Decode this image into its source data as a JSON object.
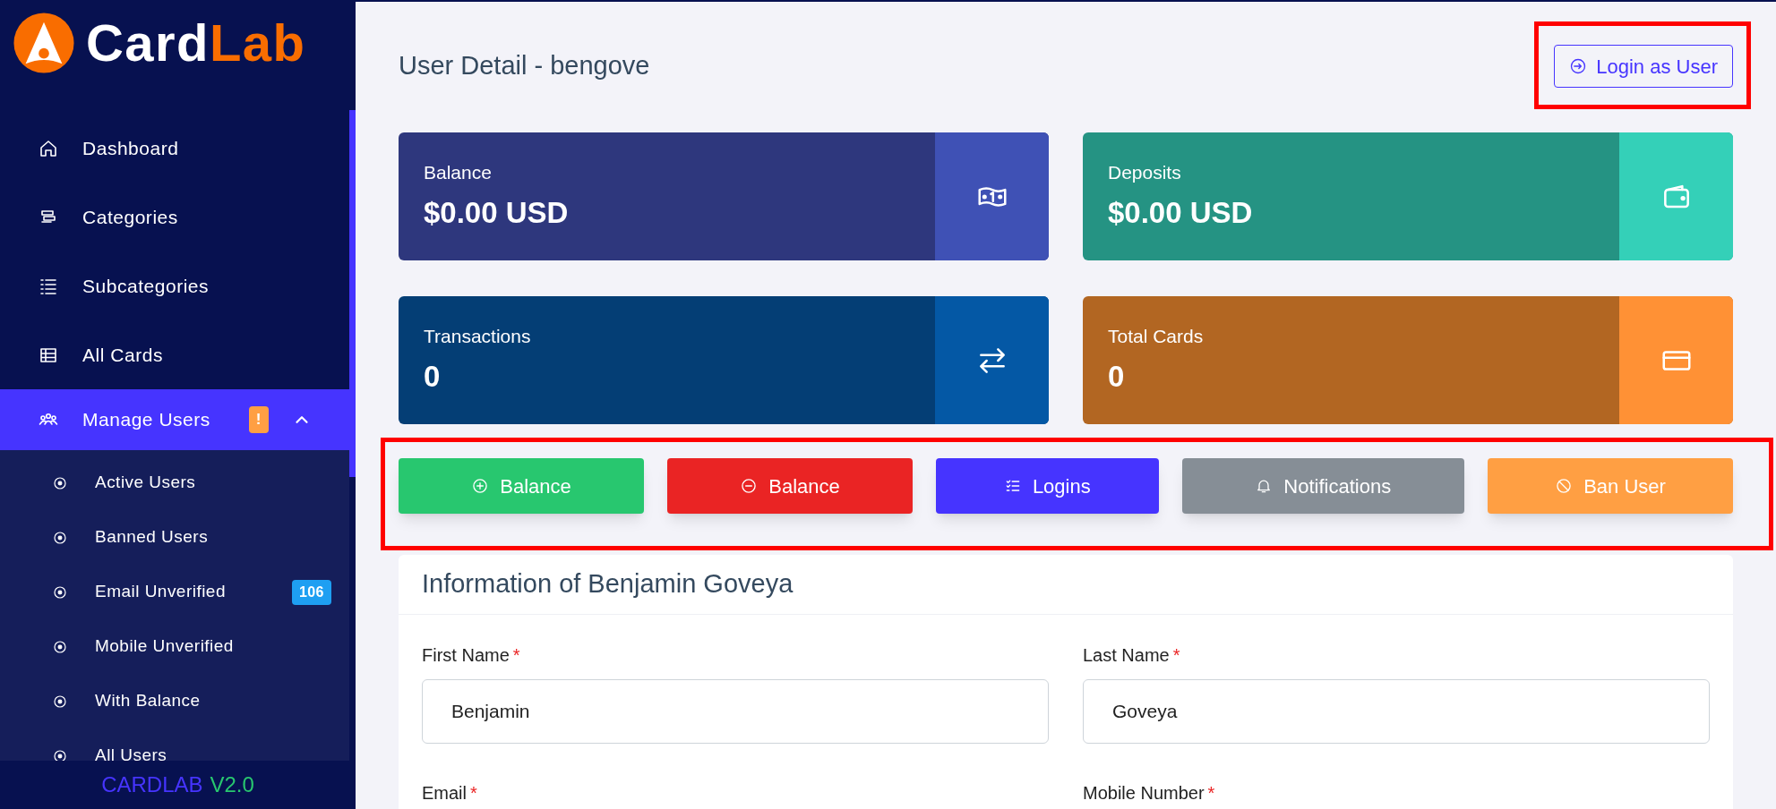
{
  "logo": {
    "text_1": "Card",
    "text_2": "Lab"
  },
  "sidebar": {
    "items": [
      {
        "label": "Dashboard",
        "kind": "link",
        "selected": false
      },
      {
        "label": "Categories",
        "kind": "link",
        "selected": false
      },
      {
        "label": "Subcategories",
        "kind": "link",
        "selected": false
      },
      {
        "label": "All Cards",
        "kind": "link",
        "selected": false
      },
      {
        "label": "Manage Users",
        "kind": "group",
        "selected": true,
        "expanded": true,
        "badge": {
          "text": "!",
          "color": "#ff9f43"
        },
        "children": [
          {
            "label": "Active Users"
          },
          {
            "label": "Banned Users"
          },
          {
            "label": "Email Unverified",
            "badge": {
              "text": "106",
              "color": "#1e9ff2"
            }
          },
          {
            "label": "Mobile Unverified"
          },
          {
            "label": "With Balance"
          },
          {
            "label": "All Users"
          }
        ]
      }
    ],
    "footer": {
      "name": "CARDLAB",
      "version": "V2.0"
    }
  },
  "header": {
    "title": "User Detail - bengove",
    "login_button": "Login as User"
  },
  "stats": [
    {
      "kind": "balance",
      "label": "Balance",
      "value": "$0.00 USD",
      "color": "#2e377d"
    },
    {
      "kind": "deposits",
      "label": "Deposits",
      "value": "$0.00 USD",
      "color": "#259383"
    },
    {
      "kind": "transactions",
      "label": "Transactions",
      "value": "0",
      "color": "#043e75"
    },
    {
      "kind": "cards",
      "label": "Total Cards",
      "value": "0",
      "color": "#b26622"
    }
  ],
  "actions": [
    {
      "kind": "add",
      "label": "Balance",
      "color": "#28c76f"
    },
    {
      "kind": "subtract",
      "label": "Balance",
      "color": "#ea2424"
    },
    {
      "kind": "logins",
      "label": "Logins",
      "color": "#4634ff"
    },
    {
      "kind": "notifications",
      "label": "Notifications",
      "color": "#868e96"
    },
    {
      "kind": "ban",
      "label": "Ban User",
      "color": "#ff9f43"
    }
  ],
  "info": {
    "title": "Information of Benjamin Goveya",
    "required_mark": "*",
    "fields": [
      {
        "label": "First Name",
        "required": true,
        "value": "Benjamin",
        "kind": "text"
      },
      {
        "label": "Last Name",
        "required": true,
        "value": "Goveya",
        "kind": "text"
      },
      {
        "label": "Email",
        "required": true,
        "kind": "text"
      },
      {
        "label": "Mobile Number",
        "required": true,
        "kind": "phone"
      }
    ]
  }
}
